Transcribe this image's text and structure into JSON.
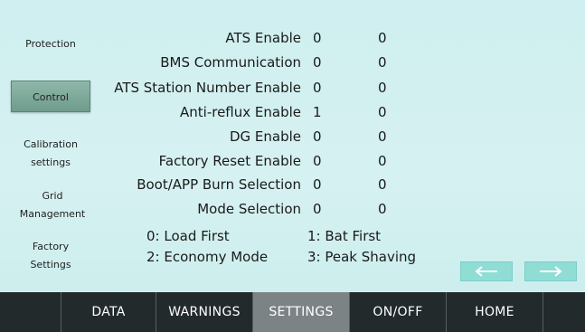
{
  "sidebar": {
    "items": [
      {
        "label": "Protection"
      },
      {
        "label": "Control"
      },
      {
        "label": "Calibration settings",
        "line1": "Calibration",
        "line2": "settings"
      },
      {
        "label": "Grid Management",
        "line1": "Grid",
        "line2": "Management"
      },
      {
        "label": "Factory Settings",
        "line1": "Factory",
        "line2": "Settings"
      }
    ],
    "active": "Control"
  },
  "settings": {
    "rows": [
      {
        "label": "ATS Enable",
        "value1": "0",
        "value2": "0"
      },
      {
        "label": "BMS Communication",
        "value1": "0",
        "value2": "0"
      },
      {
        "label": "ATS Station Number Enable",
        "value1": "0",
        "value2": "0"
      },
      {
        "label": "Anti-reflux Enable",
        "value1": "1",
        "value2": "0"
      },
      {
        "label": "DG Enable",
        "value1": "0",
        "value2": "0"
      },
      {
        "label": "Factory Reset Enable",
        "value1": "0",
        "value2": "0"
      },
      {
        "label": "Boot/APP Burn Selection",
        "value1": "0",
        "value2": "0"
      },
      {
        "label": "Mode Selection",
        "value1": "0",
        "value2": "0"
      }
    ],
    "legend": {
      "item0": "0: Load First",
      "item1": "1: Bat First",
      "item2": "2: Economy Mode",
      "item3": "3: Peak Shaving"
    }
  },
  "pager": {
    "prev_icon": "left-arrow-icon",
    "next_icon": "right-arrow-icon"
  },
  "nav": {
    "tabs": [
      {
        "label": "DATA"
      },
      {
        "label": "WARNINGS"
      },
      {
        "label": "SETTINGS"
      },
      {
        "label": "ON/OFF"
      },
      {
        "label": "HOME"
      }
    ],
    "active": "SETTINGS"
  },
  "colors": {
    "background": "#d4eeef",
    "active_sidebar": "#7fa99a",
    "nav_bar": "#222a2c",
    "active_tab": "#7c8385",
    "arrow_button": "#8fddd4"
  }
}
